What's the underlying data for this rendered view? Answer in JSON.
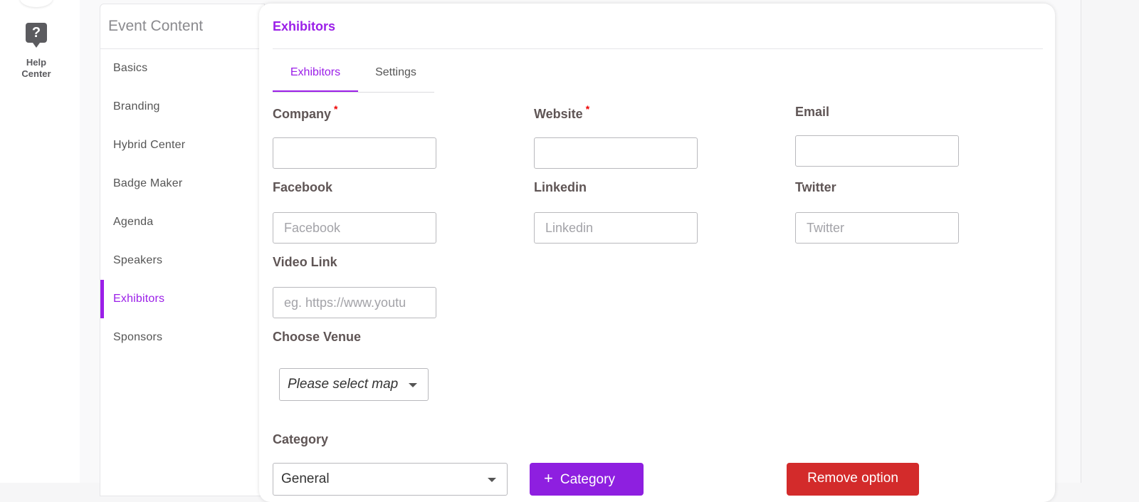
{
  "rail": {
    "help_icon_glyph": "?",
    "help_label_line1": "Help",
    "help_label_line2": "Center"
  },
  "content_nav": {
    "title": "Event Content",
    "items": [
      {
        "label": "Basics"
      },
      {
        "label": "Branding"
      },
      {
        "label": "Hybrid Center"
      },
      {
        "label": "Badge Maker"
      },
      {
        "label": "Agenda"
      },
      {
        "label": "Speakers"
      },
      {
        "label": "Exhibitors",
        "active": true
      },
      {
        "label": "Sponsors"
      }
    ]
  },
  "card": {
    "title": "Exhibitors",
    "tabs": [
      {
        "label": "Exhibitors",
        "active": true
      },
      {
        "label": "Settings"
      }
    ],
    "fields": {
      "company": {
        "label": "Company",
        "required_mark": "*",
        "value": "",
        "placeholder": ""
      },
      "website": {
        "label": "Website",
        "required_mark": "*",
        "value": "",
        "placeholder": ""
      },
      "email": {
        "label": "Email",
        "value": "",
        "placeholder": ""
      },
      "facebook": {
        "label": "Facebook",
        "placeholder": "Facebook"
      },
      "linkedin": {
        "label": "Linkedin",
        "placeholder": "Linkedin"
      },
      "twitter": {
        "label": "Twitter",
        "placeholder": "Twitter"
      },
      "video_link": {
        "label": "Video Link",
        "placeholder": "eg. https://www.youtu"
      },
      "venue": {
        "label": "Choose Venue",
        "selected": "Please select map"
      },
      "category": {
        "label": "Category",
        "selected": "General"
      }
    },
    "buttons": {
      "add_category": "Category",
      "add_category_icon": "+",
      "remove_option": "Remove option"
    }
  },
  "colors": {
    "accent": "#9b1fe8",
    "danger": "#d32b2b",
    "required": "#ee0000"
  }
}
